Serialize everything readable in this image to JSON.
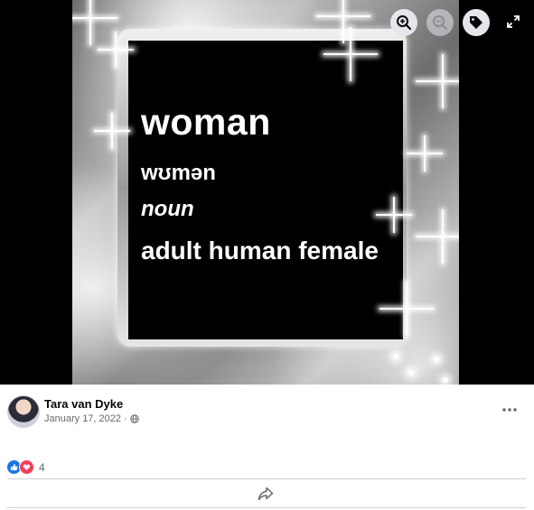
{
  "photo": {
    "word": "woman",
    "pronunciation": "wʊmən",
    "part_of_speech": "noun",
    "definition": "adult human female"
  },
  "controls": {
    "zoom_in_icon": "zoom-in-icon",
    "zoom_out_icon": "zoom-out-icon",
    "tag_icon": "tag-icon",
    "expand_icon": "expand-icon"
  },
  "post": {
    "author": "Tara van Dyke",
    "date": "January 17, 2022",
    "separator": "·",
    "privacy_icon": "globe-icon",
    "reaction_count": "4",
    "reaction_icons": [
      "like-icon",
      "love-icon"
    ]
  },
  "colors": {
    "like": "#1b74e4",
    "love": "#f33e58",
    "secondary_text": "#65676b"
  }
}
